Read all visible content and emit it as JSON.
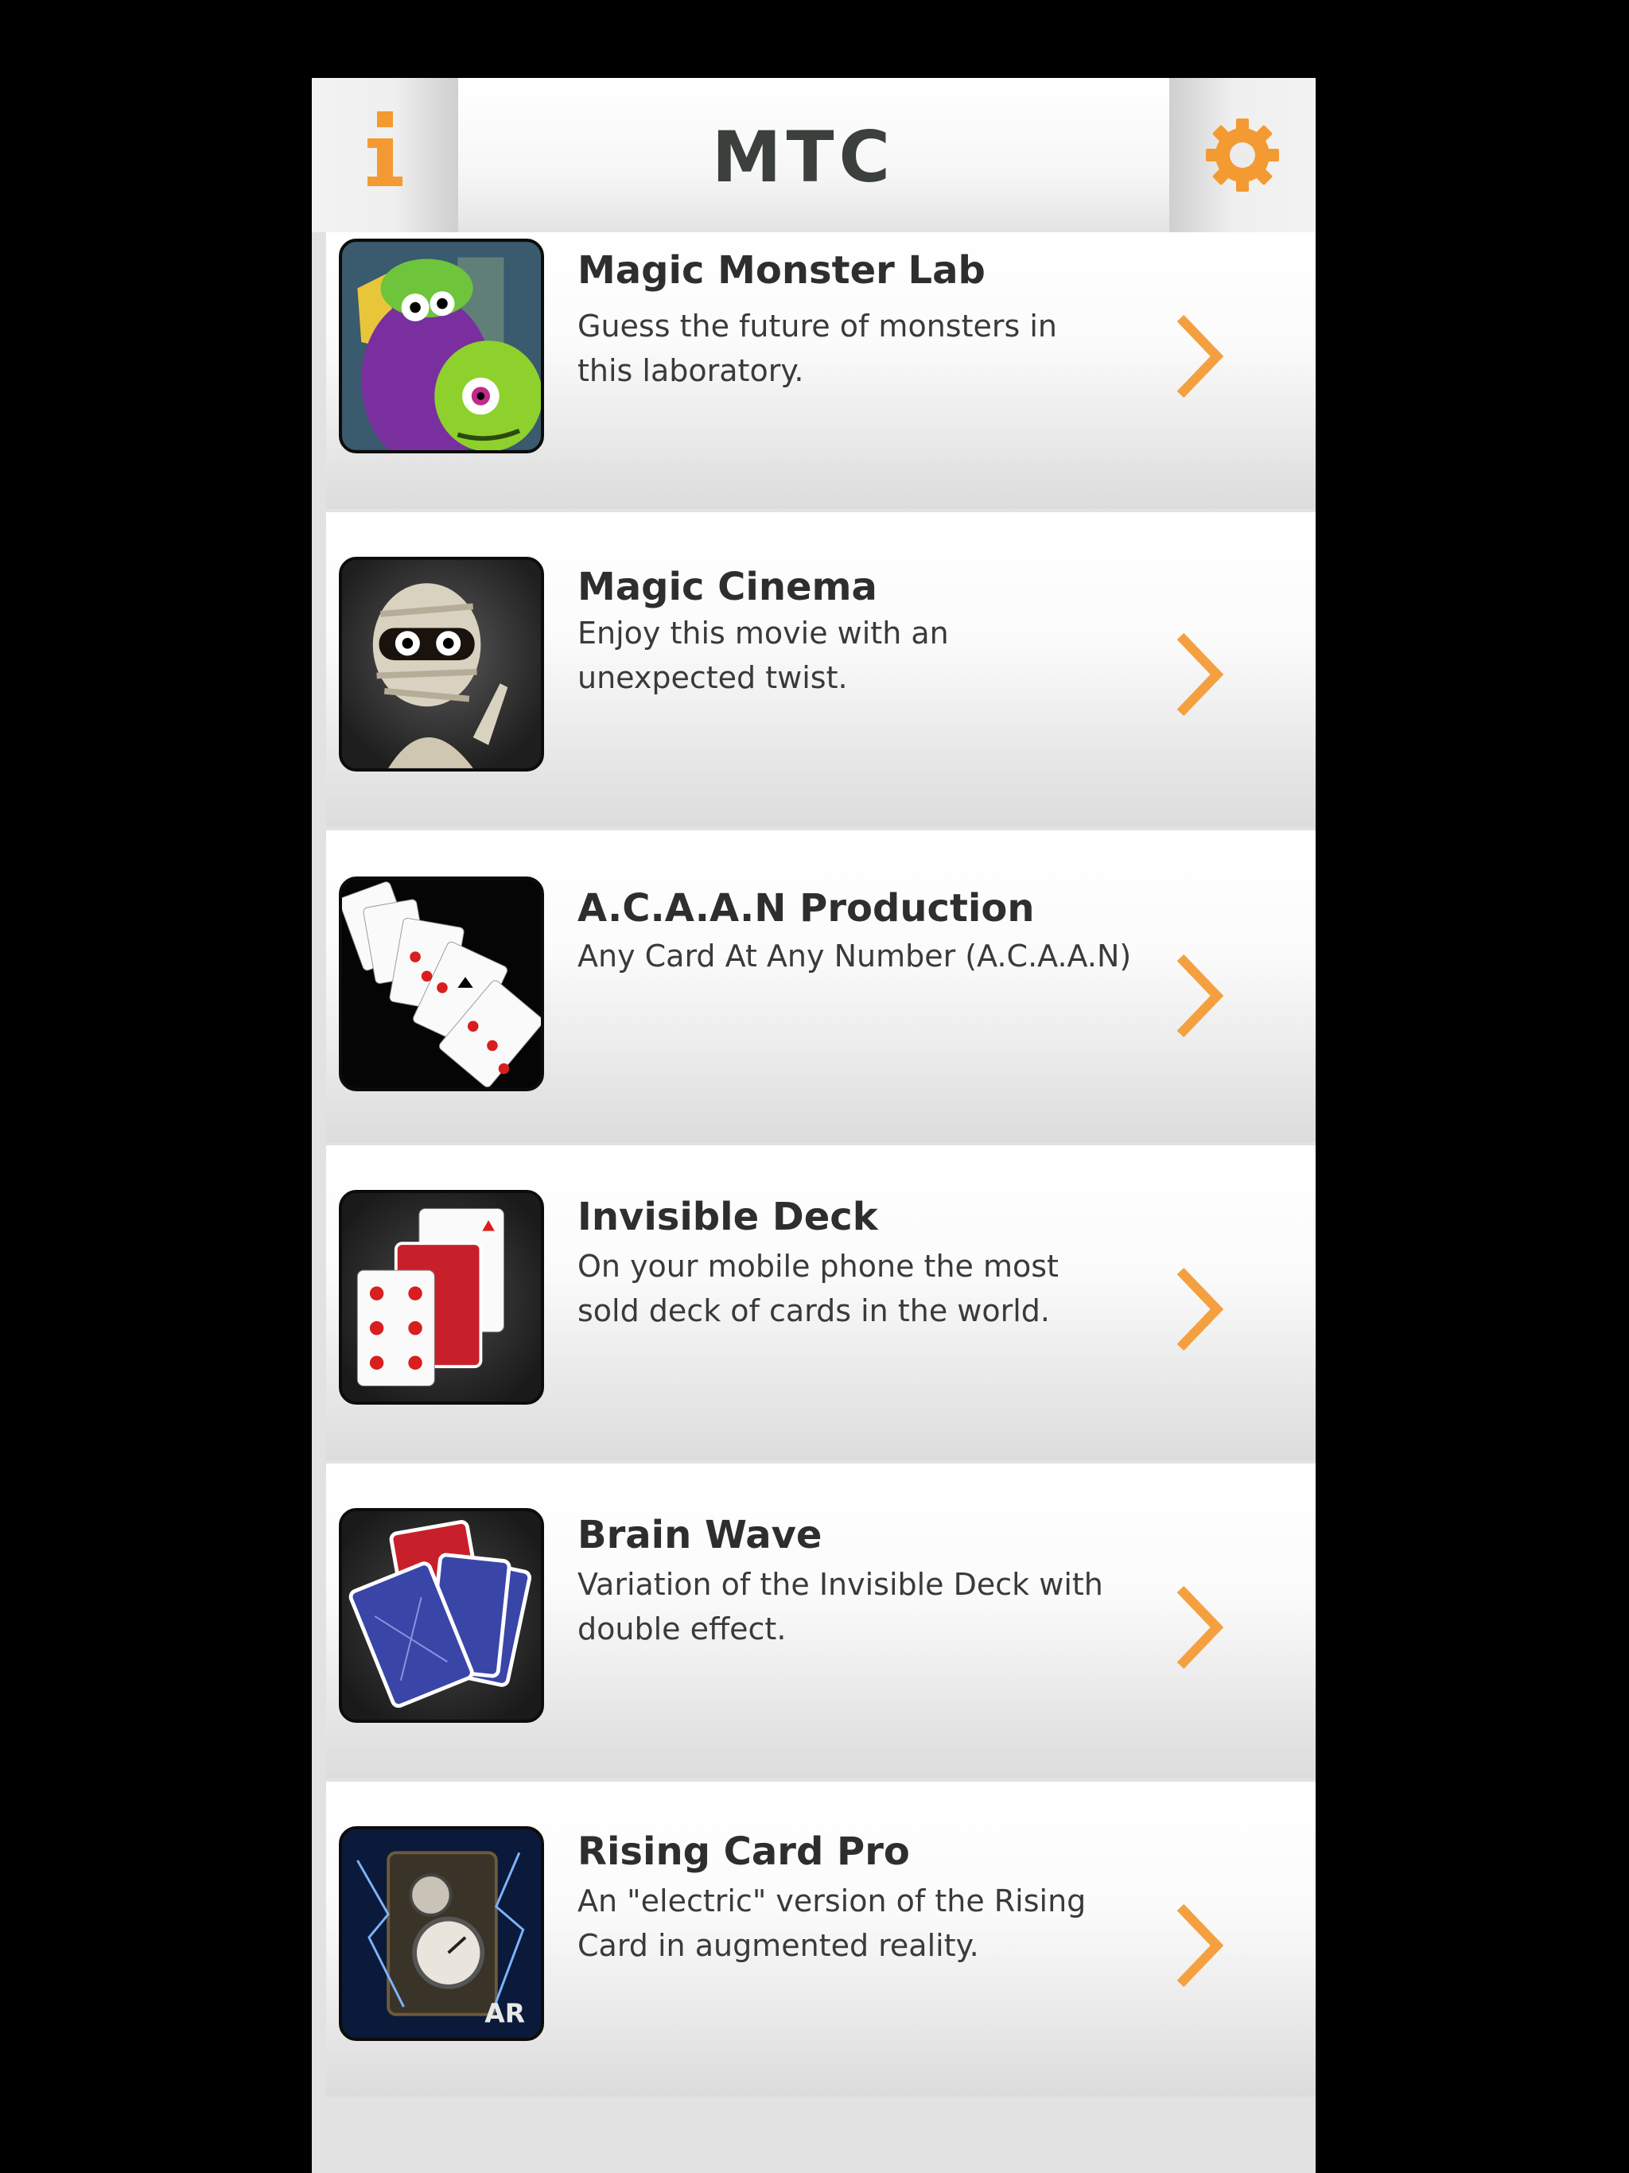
{
  "header": {
    "title": "MTC",
    "info_icon": "info-icon",
    "settings_icon": "gear-icon",
    "accent_color": "#f39a32"
  },
  "items": [
    {
      "title": "Magic Monster Lab",
      "description": "Guess the future of monsters in this laboratory.",
      "thumbnail_icon": "monster-lab-thumbnail"
    },
    {
      "title": "Magic Cinema",
      "description": "Enjoy this movie with an unexpected twist.",
      "thumbnail_icon": "mummy-thumbnail"
    },
    {
      "title": "A.C.A.A.N Production",
      "description": "Any Card At Any Number (A.C.A.A.N)",
      "thumbnail_icon": "playing-cards-spread-thumbnail"
    },
    {
      "title": "Invisible Deck",
      "description": "On your mobile phone the most sold deck of cards in the world.",
      "thumbnail_icon": "card-deck-thumbnail"
    },
    {
      "title": "Brain Wave",
      "description": "Variation of the Invisible Deck with double effect.",
      "thumbnail_icon": "card-backs-thumbnail"
    },
    {
      "title": "Rising Card Pro",
      "description": "An \"electric\" version of the Rising Card in augmented reality.",
      "thumbnail_icon": "rising-card-ar-thumbnail",
      "badge": "AR"
    }
  ]
}
